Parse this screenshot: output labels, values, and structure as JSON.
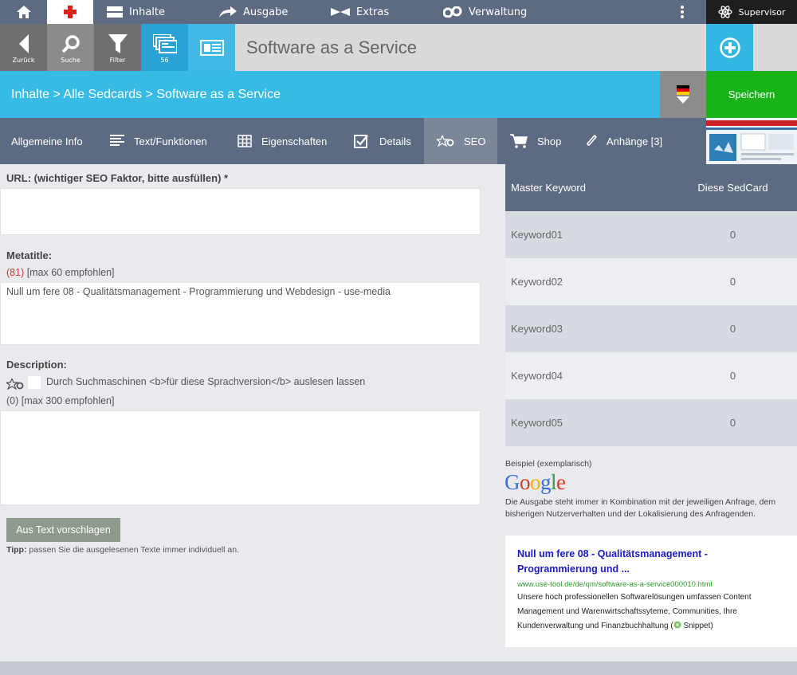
{
  "topnav": {
    "items": [
      {
        "label": "Inhalte",
        "icon": "content-icon"
      },
      {
        "label": "Ausgabe",
        "icon": "export-arrow-icon"
      },
      {
        "label": "Extras",
        "icon": "extras-icon"
      },
      {
        "label": "Verwaltung",
        "icon": "gears-icon"
      }
    ],
    "user": "Supervisor"
  },
  "toolbar": {
    "back_label": "Zurück",
    "search_label": "Suche",
    "filter_label": "Filter",
    "cards_count": "56",
    "title": "Software as a Service"
  },
  "breadcrumb": {
    "text": "Inhalte > Alle Sedcards > Software as a Service",
    "save_label": "Speichern"
  },
  "tabs": [
    {
      "label": "Allgemeine Info"
    },
    {
      "label": "Text/Funktionen"
    },
    {
      "label": "Eigenschaften"
    },
    {
      "label": "Details"
    },
    {
      "label": "SEO"
    },
    {
      "label": "Shop"
    },
    {
      "label": "Anhänge [3]"
    }
  ],
  "form": {
    "url_label": "URL: (wichtiger SEO Faktor, bitte ausfüllen) *",
    "url_value": "",
    "metatitle_label": "Metatitle:",
    "metatitle_count": "(81)",
    "metatitle_hint": " [max 60 empfohlen]",
    "metatitle_value": "Null um fere 08 - Qualitätsmanagement - Programmierung und Webdesign - use-media",
    "description_label": "Description:",
    "crawl_label": "Durch Suchmaschinen <b>für diese Sprachversion</b> auslesen lassen",
    "description_hint": "(0) [max 300 empfohlen]",
    "description_value": "",
    "suggest_button": "Aus Text vorschlagen",
    "tip_bold": "Tipp:",
    "tip_text": " passen Sie die ausgelesenen Texte immer individuell an."
  },
  "keywords": {
    "header": [
      "Master Keyword",
      "Diese SedCard"
    ],
    "rows": [
      {
        "keyword": "Keyword01",
        "count": "0"
      },
      {
        "keyword": "Keyword02",
        "count": "0"
      },
      {
        "keyword": "Keyword03",
        "count": "0"
      },
      {
        "keyword": "Keyword04",
        "count": "0"
      },
      {
        "keyword": "Keyword05",
        "count": "0"
      }
    ]
  },
  "preview": {
    "example_label": "Beispiel (exemplarisch)",
    "google_logo": "Google",
    "note": "Die Ausgabe steht immer in Kombination mit der jeweiligen Anfrage, dem bisherigen Nutzerverhalten und der Lokalisierung des Anfragenden.",
    "snippet_title": "Null um fere 08 - Qualitätsmanagement - Programmierung und ...",
    "snippet_url": "www.use-tool.de/de/qm/software-as-a-service000010.html",
    "snippet_desc": "Unsere hoch professionellen Softwarelösungen umfassen Content Management und Warenwirtschaftssyteme, Communities, Ihre Kundenverwaltung und Finanzbuchhaltung (",
    "snippet_link": " Snippet)"
  },
  "colors": {
    "nav": "#5d6b82",
    "accent": "#37bbe4",
    "save": "#19b319"
  }
}
